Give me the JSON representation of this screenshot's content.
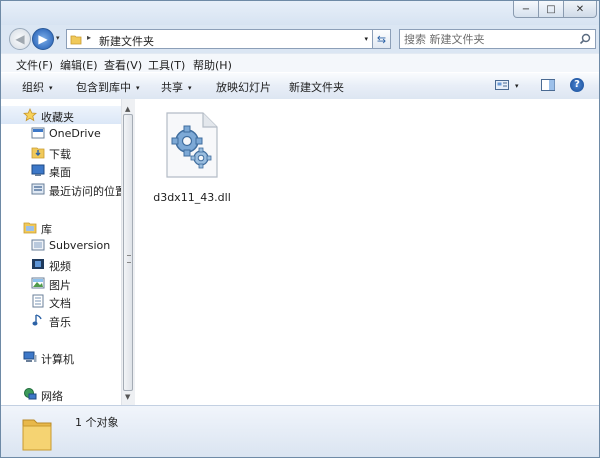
{
  "window": {
    "min_glyph": "−",
    "max_glyph": "□",
    "close_glyph": "✕"
  },
  "address": {
    "path": "新建文件夹",
    "separator": "▸",
    "dropdown": "▾",
    "refresh_glyph": "⇆"
  },
  "search": {
    "placeholder": "搜索 新建文件夹"
  },
  "nav_buttons": {
    "back_glyph": "◀",
    "forward_glyph": "▶",
    "history_glyph": "▾"
  },
  "menu": [
    "文件(F)",
    "编辑(E)",
    "查看(V)",
    "工具(T)",
    "帮助(H)"
  ],
  "toolbar": {
    "organize": "组织",
    "include_in_library": "包含到库中",
    "share": "共享",
    "slideshow": "放映幻灯片",
    "new_folder": "新建文件夹",
    "caret": "▾",
    "help": "?"
  },
  "sidebar": {
    "favorites": {
      "label": "收藏夹",
      "items": [
        "OneDrive",
        "下载",
        "桌面",
        "最近访问的位置"
      ]
    },
    "libraries": {
      "label": "库",
      "items": [
        "Subversion",
        "视频",
        "图片",
        "文档",
        "音乐"
      ]
    },
    "computer": {
      "label": "计算机"
    },
    "network": {
      "label": "网络"
    }
  },
  "scrollbar": {
    "up": "▲",
    "down": "▼"
  },
  "files": [
    {
      "name": "d3dx11_43.dll",
      "icon": "dll-gear-icon"
    }
  ],
  "status": {
    "count_text": "1 个对象"
  },
  "colors": {
    "accent": "#1c58b0",
    "nav_selected": "#dbe7f7",
    "folder": "#f0c95a"
  }
}
